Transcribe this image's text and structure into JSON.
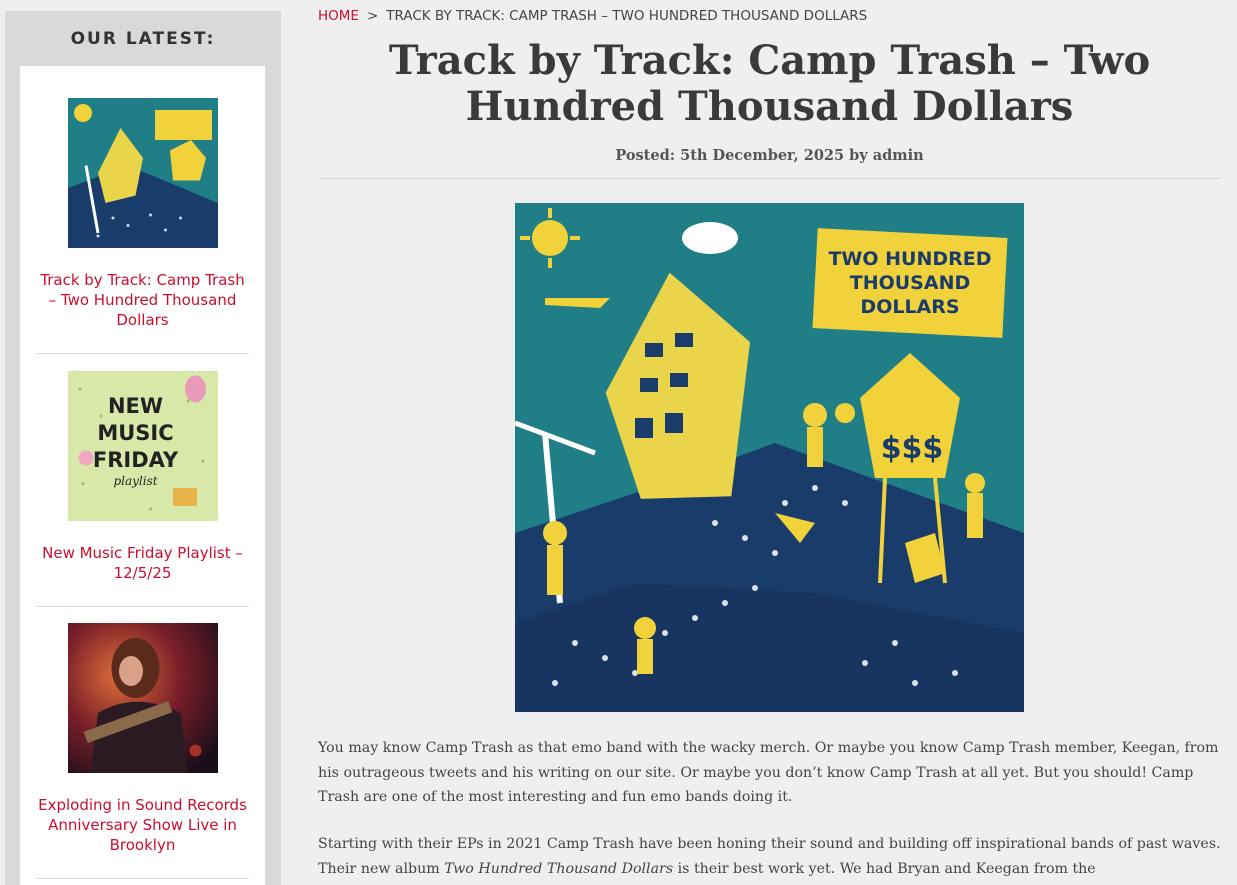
{
  "sidebar": {
    "title": "OUR LATEST:",
    "posts": [
      {
        "title": "Track by Track: Camp Trash – Two Hundred Thousand Dollars"
      },
      {
        "title": "New Music Friday Playlist – 12/5/25"
      },
      {
        "title": "Exploding in Sound Records Anniversary Show Live in Brooklyn"
      }
    ],
    "thumb_new_music_lines": [
      "NEW",
      "MUSIC",
      "FRIDAY",
      "playlist"
    ]
  },
  "breadcrumb": {
    "home": "HOME",
    "separator": ">",
    "current": "TRACK BY TRACK: CAMP TRASH – TWO HUNDRED THOUSAND DOLLARS"
  },
  "article": {
    "title": "Track by Track: Camp Trash – Two Hundred Thousand Dollars",
    "meta": "Posted: 5th December, 2025 by admin",
    "cover_lines": [
      "TWO HUNDRED",
      "THOUSAND",
      "DOLLARS"
    ],
    "cover_money": "$$$",
    "para1": "You may know Camp Trash as that emo band with the wacky merch. Or maybe you know Camp Trash member, Keegan, from his outrageous tweets and his writing on our site. Or maybe you don’t know Camp Trash at all yet. But you should! Camp Trash are one of the most interesting and fun emo bands doing it.",
    "para2_a": "Starting with their EPs in 2021 Camp Trash have been honing their sound and building off inspirational bands of past waves. Their new album ",
    "para2_em": "Two Hundred Thousand Dollars",
    "para2_b": " is their best work yet. We had Bryan and Keegan from the"
  },
  "colors": {
    "accent": "#c8102e",
    "cover_blue": "#1f7e86",
    "cover_yellow": "#f2d23a"
  }
}
